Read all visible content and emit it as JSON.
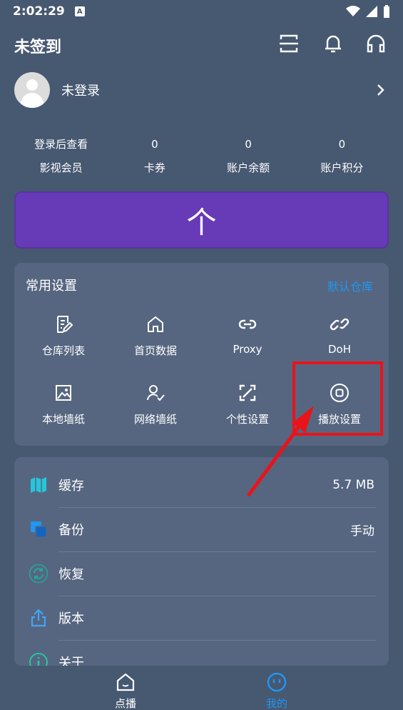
{
  "status_bar": {
    "time": "2:02:29",
    "badge": "A"
  },
  "header": {
    "title": "未签到"
  },
  "profile": {
    "name": "未登录"
  },
  "stats": [
    {
      "value": "登录后查看",
      "label": "影视会员"
    },
    {
      "value": "0",
      "label": "卡券"
    },
    {
      "value": "0",
      "label": "账户余额"
    },
    {
      "value": "0",
      "label": "账户积分"
    }
  ],
  "main_button": {
    "symbol": "个"
  },
  "settings": {
    "title": "常用设置",
    "link": "默认仓库",
    "items": [
      {
        "label": "仓库列表"
      },
      {
        "label": "首页数据"
      },
      {
        "label": "Proxy"
      },
      {
        "label": "DoH"
      },
      {
        "label": "本地墙纸"
      },
      {
        "label": "网络墙纸"
      },
      {
        "label": "个性设置"
      },
      {
        "label": "播放设置"
      }
    ]
  },
  "list": [
    {
      "label": "缓存",
      "value": "5.7 MB"
    },
    {
      "label": "备份",
      "value": "手动"
    },
    {
      "label": "恢复",
      "value": ""
    },
    {
      "label": "版本",
      "value": ""
    },
    {
      "label": "关于",
      "value": ""
    }
  ],
  "bottom_nav": [
    {
      "label": "点播"
    },
    {
      "label": "我的"
    }
  ],
  "colors": {
    "background": "#475871",
    "card": "#566680",
    "accent_purple": "#673ab7",
    "link_blue": "#2196f3",
    "highlight_red": "#e8141a"
  }
}
